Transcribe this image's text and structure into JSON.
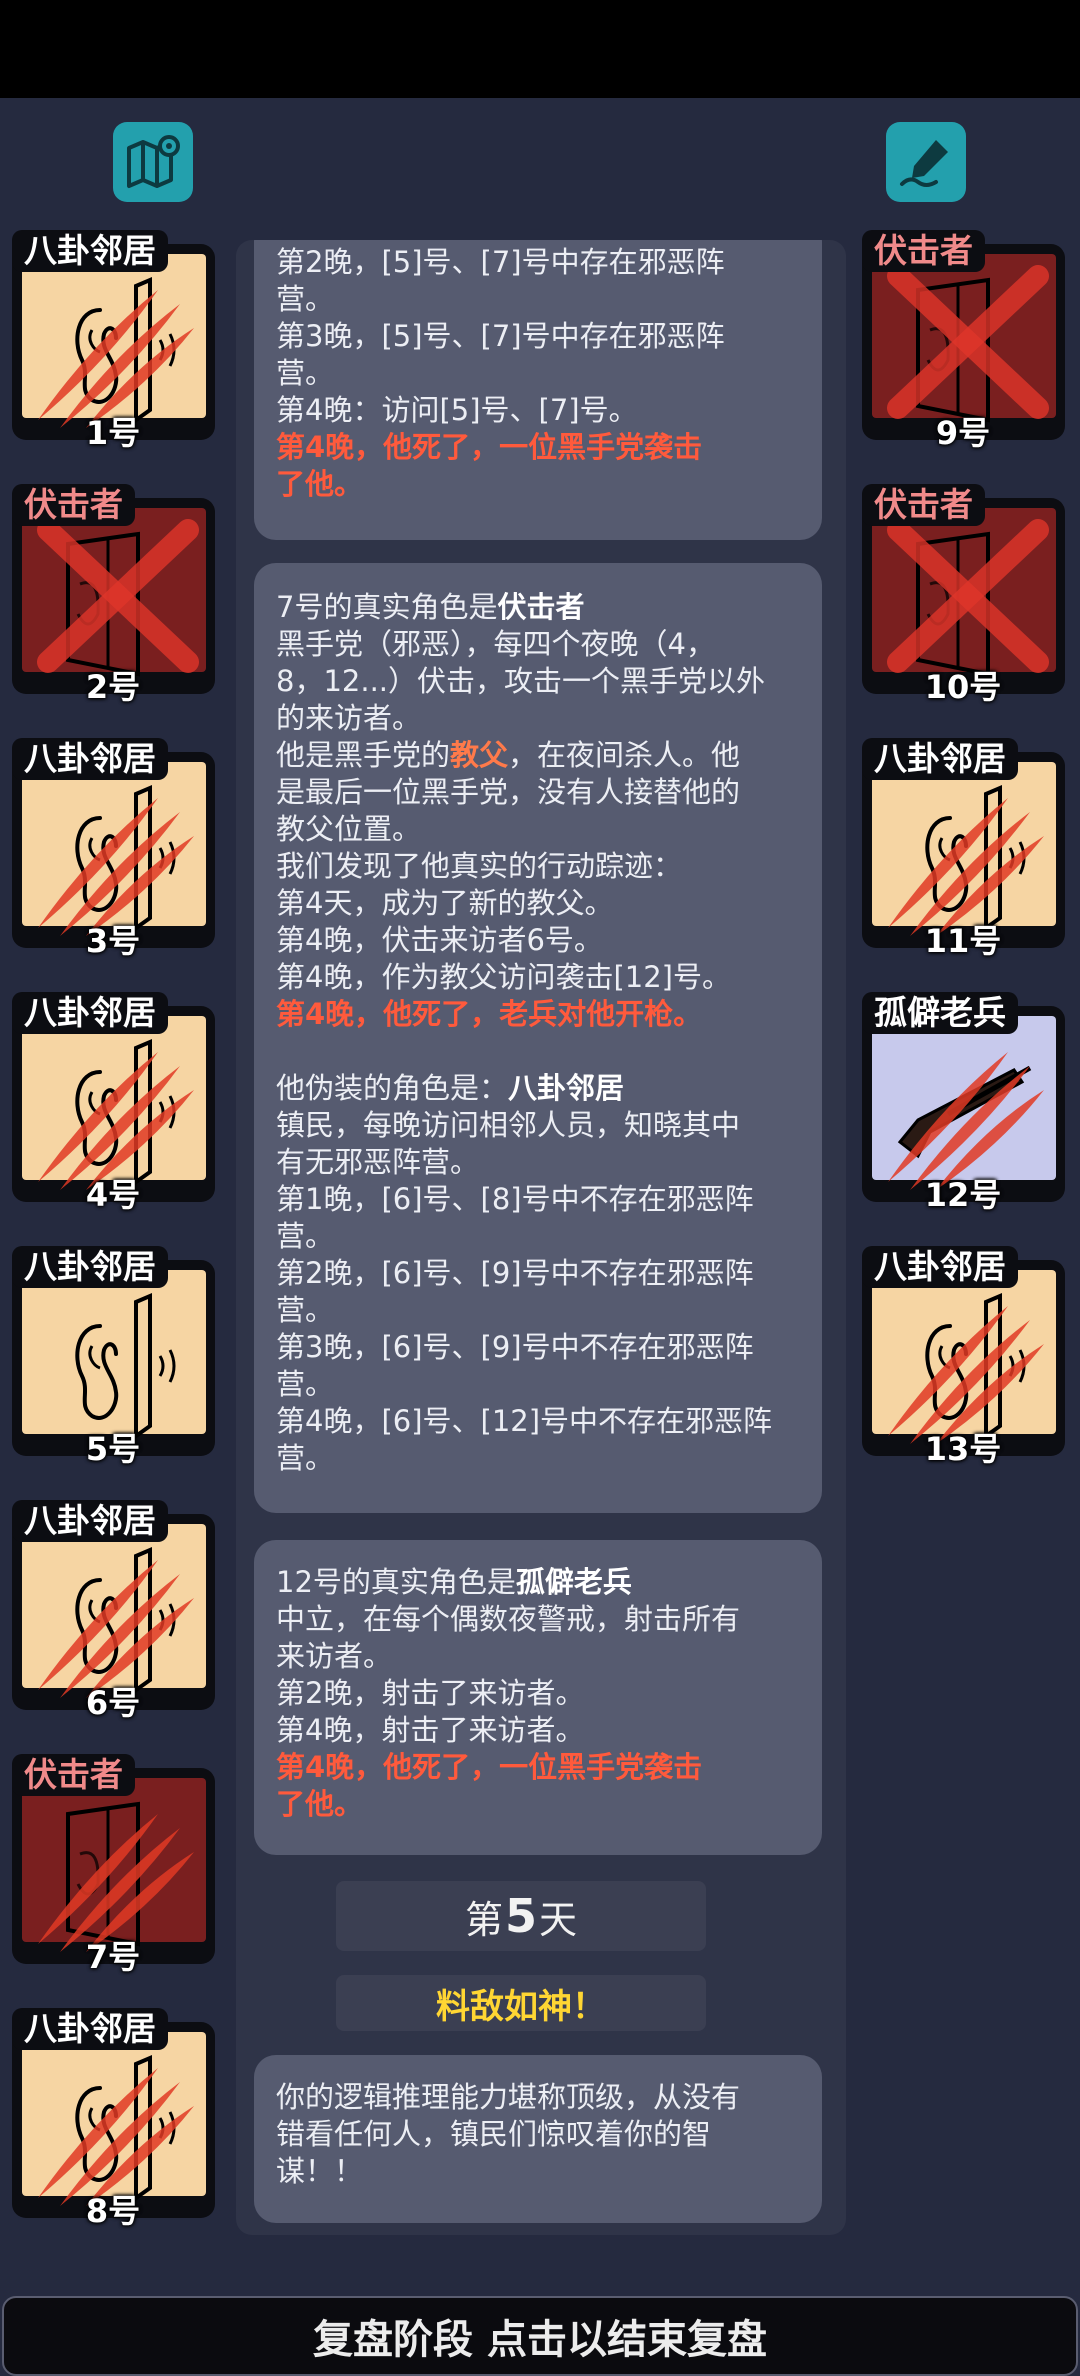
{
  "topbar": {
    "map_icon": "map-pin-icon",
    "note_icon": "pen-note-icon"
  },
  "left_players": [
    {
      "role": "八卦邻居",
      "number": "1号",
      "role_type": "villager",
      "status": "dead"
    },
    {
      "role": "伏击者",
      "number": "2号",
      "role_type": "ambusher",
      "status": "crossed"
    },
    {
      "role": "八卦邻居",
      "number": "3号",
      "role_type": "villager",
      "status": "dead"
    },
    {
      "role": "八卦邻居",
      "number": "4号",
      "role_type": "villager",
      "status": "dead"
    },
    {
      "role": "八卦邻居",
      "number": "5号",
      "role_type": "villager",
      "status": "alive"
    },
    {
      "role": "八卦邻居",
      "number": "6号",
      "role_type": "villager",
      "status": "dead"
    },
    {
      "role": "伏击者",
      "number": "7号",
      "role_type": "ambusher",
      "status": "dead"
    },
    {
      "role": "八卦邻居",
      "number": "8号",
      "role_type": "villager",
      "status": "dead"
    }
  ],
  "right_players": [
    {
      "role": "伏击者",
      "number": "9号",
      "role_type": "ambusher",
      "status": "crossed"
    },
    {
      "role": "伏击者",
      "number": "10号",
      "role_type": "ambusher",
      "status": "crossed"
    },
    {
      "role": "八卦邻居",
      "number": "11号",
      "role_type": "villager",
      "status": "dead"
    },
    {
      "role": "孤僻老兵",
      "number": "12号",
      "role_type": "veteran",
      "status": "dead"
    },
    {
      "role": "八卦邻居",
      "number": "13号",
      "role_type": "villager",
      "status": "dead"
    }
  ],
  "log": {
    "entry1": {
      "lines": [
        "第2晚，[5]号、[7]号中存在邪恶阵",
        "营。",
        "第3晚，[5]号、[7]号中存在邪恶阵",
        "营。",
        "第4晚：访问[5]号、[7]号。"
      ],
      "death": [
        "第4晚，他死了，一位黑手党袭击",
        "了他。"
      ]
    },
    "entry2": {
      "head_prefix": "7号的真实角色是",
      "head_role": "伏击者",
      "desc": [
        "黑手党（邪恶），每四个夜晚（4，",
        "8，12...）伏击，攻击一个黑手党以外",
        "的来访者。"
      ],
      "godfather_pre": "他是黑手党的",
      "godfather_word": "教父",
      "godfather_post": "，在夜间杀人。他",
      "more": [
        "是最后一位黑手党，没有人接替他的",
        "教父位置。",
        "我们发现了他真实的行动踪迹：",
        "第4天，成为了新的教父。",
        "第4晚，伏击来访者6号。",
        "第4晚，作为教父访问袭击[12]号。"
      ],
      "death": "第4晚，他死了，老兵对他开枪。",
      "disguise_prefix": "他伪装的角色是：",
      "disguise_role": "八卦邻居",
      "disguise_lines": [
        "镇民，每晚访问相邻人员，知晓其中",
        "有无邪恶阵营。",
        "第1晚，[6]号、[8]号中不存在邪恶阵",
        "营。",
        "第2晚，[6]号、[9]号中不存在邪恶阵",
        "营。",
        "第3晚，[6]号、[9]号中不存在邪恶阵",
        "营。",
        "第4晚，[6]号、[12]号中不存在邪恶阵",
        "营。"
      ]
    },
    "entry3": {
      "head_prefix": "12号的真实角色是",
      "head_role": "孤僻老兵",
      "desc": [
        "中立，在每个偶数夜警戒，射击所有",
        "来访者。",
        "第2晚，射击了来访者。",
        "第4晚，射击了来访者。"
      ],
      "death": [
        "第4晚，他死了，一位黑手党袭击",
        "了他。"
      ]
    },
    "day": {
      "prefix": "第",
      "number": "5",
      "suffix": "天"
    },
    "rank": "料敌如神！",
    "summary": [
      "你的逻辑推理能力堪称顶级，从没有",
      "错看任何人，镇民们惊叹着你的智",
      "谋！！"
    ]
  },
  "footer": {
    "label": "复盘阶段 点击以结束复盘"
  },
  "colors": {
    "accent_teal": "#23a0ad",
    "death_red": "#ff5a3c",
    "rank_yellow": "#ffd633",
    "evil_role": "#f08a8a"
  }
}
